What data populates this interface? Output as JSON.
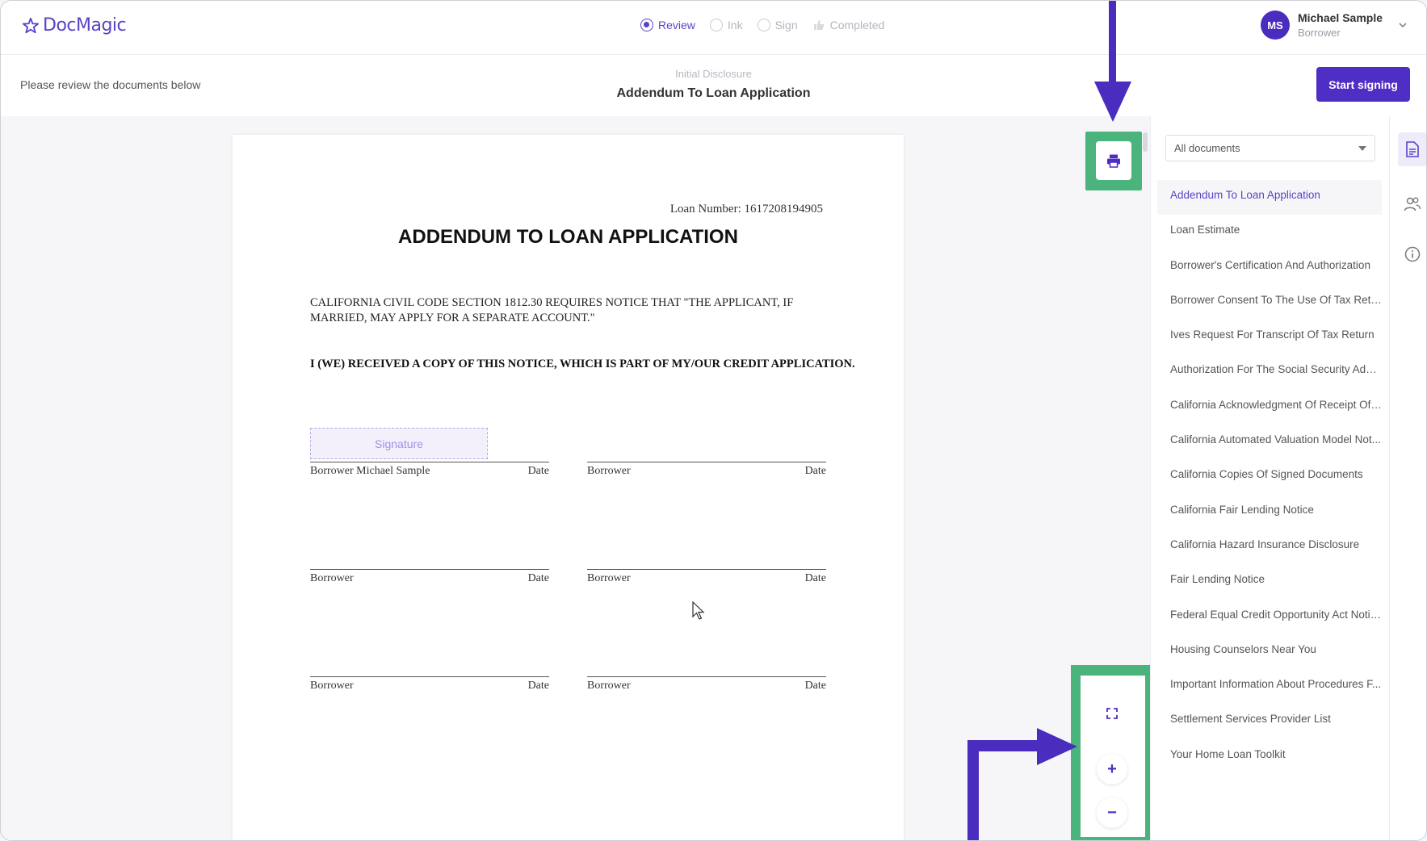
{
  "app": {
    "name": "DocMagic",
    "brand_color": "#5a43c8",
    "accent": "#4f2ec5",
    "highlight_color": "#4ab47c"
  },
  "progress_steps": [
    {
      "label": "Review",
      "state": "active"
    },
    {
      "label": "Ink",
      "state": "pending"
    },
    {
      "label": "Sign",
      "state": "pending"
    },
    {
      "label": "Completed",
      "state": "pending"
    }
  ],
  "user": {
    "initials": "MS",
    "name": "Michael Sample",
    "role": "Borrower"
  },
  "subheader": {
    "instruction": "Please review the documents below",
    "package": "Initial Disclosure",
    "title": "Addendum To Loan Application",
    "start_label": "Start signing"
  },
  "document": {
    "loan_number": "Loan Number: 1617208194905",
    "heading": "ADDENDUM TO LOAN APPLICATION",
    "notice": "CALIFORNIA CIVIL CODE SECTION 1812.30 REQUIRES NOTICE THAT \"THE APPLICANT, IF MARRIED, MAY APPLY FOR A SEPARATE ACCOUNT.\"",
    "acknowledgement": "I (WE) RECEIVED A COPY OF THIS NOTICE, WHICH IS PART OF MY/OUR CREDIT APPLICATION.",
    "signature_placeholder": "Signature",
    "signature_lines": [
      {
        "label": "Borrower Michael Sample",
        "date": "Date"
      },
      {
        "label": "Borrower",
        "date": "Date"
      },
      {
        "label": "Borrower",
        "date": "Date"
      },
      {
        "label": "Borrower",
        "date": "Date"
      },
      {
        "label": "Borrower",
        "date": "Date"
      },
      {
        "label": "Borrower",
        "date": "Date"
      }
    ]
  },
  "controls": {
    "print_icon": "printer-icon",
    "fullscreen_icon": "fullscreen-icon",
    "zoom_in_symbol": "+",
    "zoom_out_symbol": "−"
  },
  "sidebar": {
    "filter": "All documents",
    "documents": [
      "Addendum To Loan Application",
      "Loan Estimate",
      "Borrower's Certification And Authorization",
      "Borrower Consent To The Use Of Tax Retur...",
      "Ives Request For Transcript Of Tax Return",
      "Authorization For The Social Security Admi...",
      "California Acknowledgment Of Receipt Of ...",
      "California Automated Valuation Model Not...",
      "California Copies Of Signed Documents",
      "California Fair Lending Notice",
      "California Hazard Insurance Disclosure",
      "Fair Lending Notice",
      "Federal Equal Credit Opportunity Act Notic...",
      "Housing Counselors Near You",
      "Important Information About Procedures F...",
      "Settlement Services Provider List",
      "Your Home Loan Toolkit"
    ]
  },
  "iconbar": [
    "document-icon",
    "users-icon",
    "info-icon"
  ]
}
